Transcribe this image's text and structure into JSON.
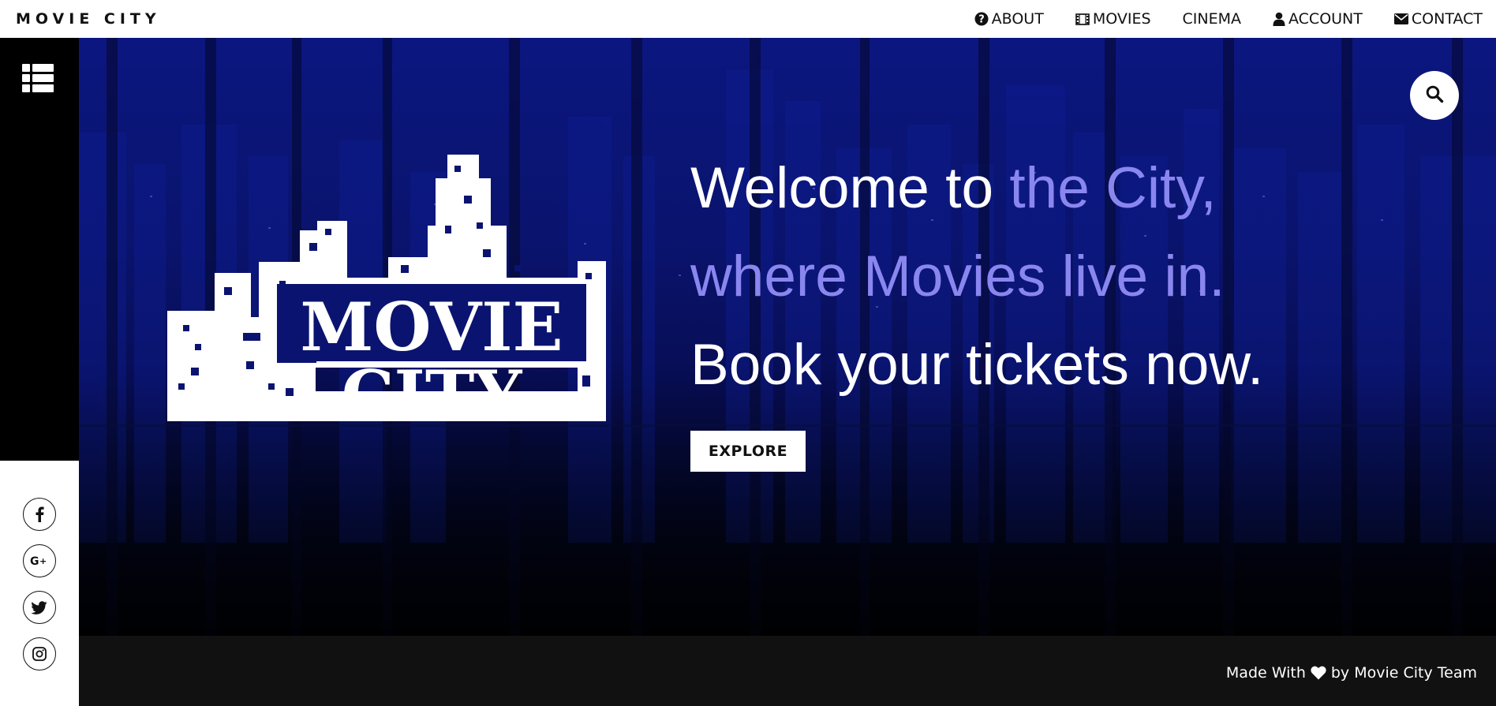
{
  "header": {
    "brand": "MOVIE CITY",
    "nav": [
      {
        "label": "ABOUT",
        "icon": "question-circle-icon"
      },
      {
        "label": "MOVIES",
        "icon": "film-icon"
      },
      {
        "label": "CINEMA",
        "icon": ""
      },
      {
        "label": "ACCOUNT",
        "icon": "user-icon"
      },
      {
        "label": "CONTACT",
        "icon": "envelope-icon"
      }
    ]
  },
  "sidebar": {
    "menu_icon": "list-icon",
    "social": [
      "facebook-icon",
      "google-plus-icon",
      "twitter-icon",
      "instagram-icon"
    ]
  },
  "hero": {
    "search_icon": "search-icon",
    "logo_text": [
      "MOVIE",
      "CITY"
    ],
    "headline": {
      "part1": "Welcome to ",
      "part2": "the City,",
      "line2": "where Movies live in.",
      "line3": "Book your tickets now."
    },
    "cta": "EXPLORE"
  },
  "footer": {
    "text_before": "Made With",
    "text_after": "by Movie City Team",
    "heart_icon": "heart-icon"
  },
  "colors": {
    "accent": "#8a86f0",
    "hero_top": "#0b1680",
    "footer_bg": "#111111"
  }
}
